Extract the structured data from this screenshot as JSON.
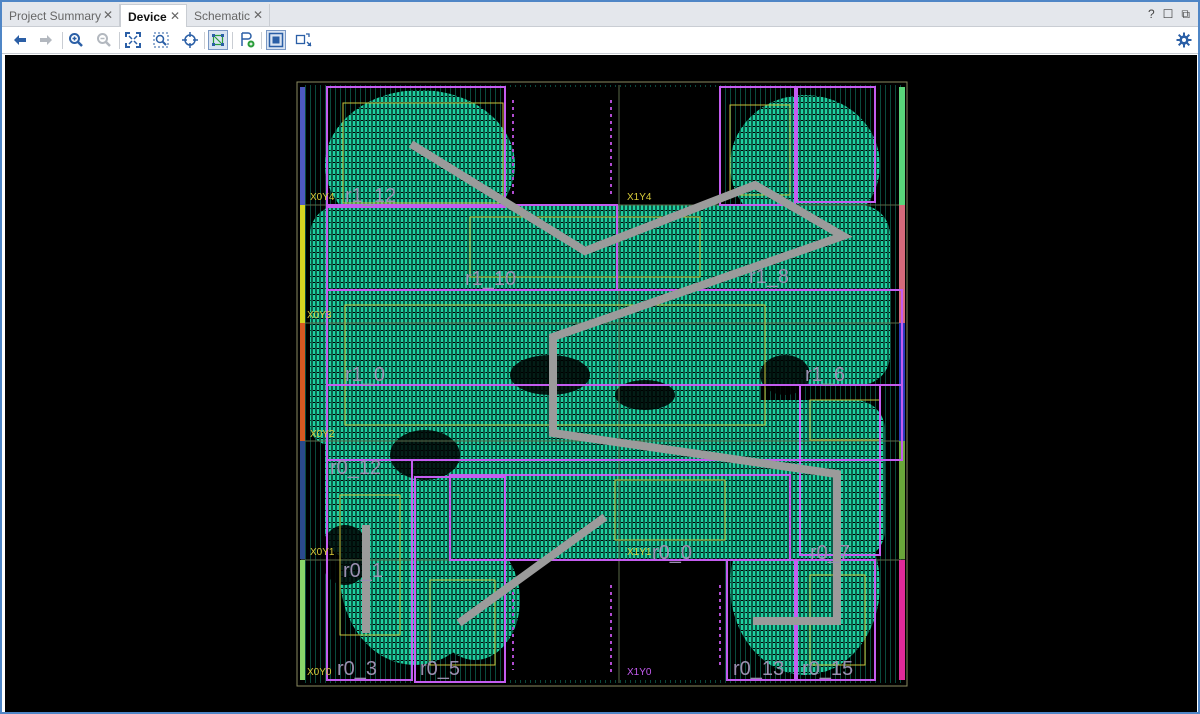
{
  "tabs": [
    {
      "label": "Project Summary",
      "active": false
    },
    {
      "label": "Device",
      "active": true
    },
    {
      "label": "Schematic",
      "active": false
    }
  ],
  "window_buttons": {
    "help": "?",
    "restore": "☐",
    "popout": "⧉"
  },
  "toolbar": {
    "icons": [
      "back-icon",
      "forward-icon",
      "zoom-in-icon",
      "zoom-out-icon",
      "zoom-fit-icon",
      "zoom-selection-icon",
      "autofit-icon",
      "routing-resources-icon",
      "place-cell-icon",
      "pblock-icon",
      "site-icon",
      "settings-icon"
    ]
  },
  "device": {
    "clock_regions": [
      "X0Y4",
      "X1Y4",
      "X0Y3",
      "X0Y2",
      "X0Y1",
      "X1Y1",
      "X0Y0",
      "X1Y0"
    ],
    "pblock_labels": [
      "r1_12",
      "r1_10",
      "r1_8",
      "r1_0",
      "r1_6",
      "r0_12",
      "r0_0",
      "r0_7",
      "r0_3",
      "r0_5",
      "r0_13",
      "r0_15",
      "r0_1"
    ],
    "colors": {
      "logic": "#1fd0a0",
      "pblock": "#c45cf0",
      "region": "#d9cc3a",
      "path": "#9b9b9b",
      "background": "#000000"
    }
  }
}
